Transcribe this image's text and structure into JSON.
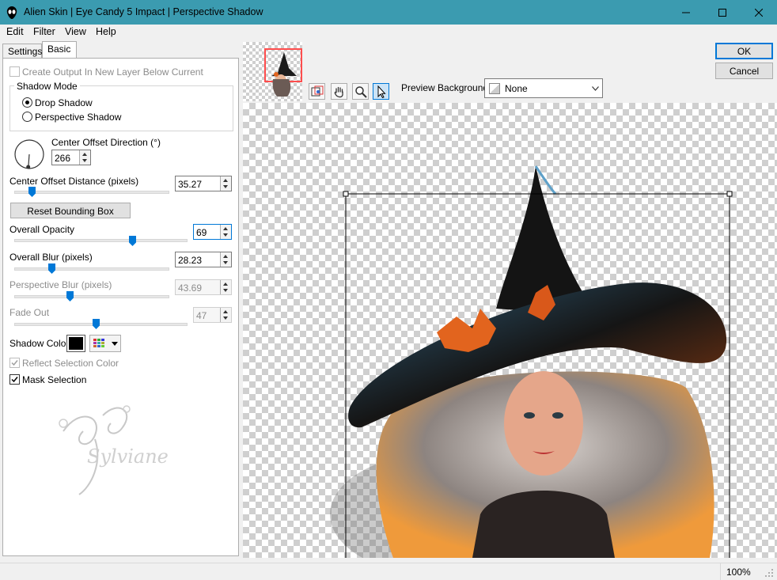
{
  "window": {
    "title": "Alien Skin | Eye Candy 5 Impact | Perspective Shadow",
    "controls": [
      "minimize-icon",
      "maximize-icon",
      "close-icon"
    ]
  },
  "menu": [
    "Edit",
    "Filter",
    "View",
    "Help"
  ],
  "tabs": [
    "Settings",
    "Basic"
  ],
  "active_tab": "Basic",
  "basic": {
    "create_output_label": "Create Output In New Layer Below Current",
    "shadow_mode": {
      "title": "Shadow Mode",
      "options": [
        "Drop Shadow",
        "Perspective Shadow"
      ],
      "selected": "Drop Shadow"
    },
    "direction": {
      "label": "Center Offset Direction (°)",
      "value": "266"
    },
    "distance": {
      "label": "Center Offset Distance (pixels)",
      "value": "35.27",
      "slider": 0.1
    },
    "reset_label": "Reset Bounding Box",
    "opacity": {
      "label": "Overall Opacity",
      "value": "69",
      "slider": 0.69
    },
    "blur": {
      "label": "Overall Blur (pixels)",
      "value": "28.23",
      "slider": 0.24
    },
    "perspective_blur": {
      "label": "Perspective Blur (pixels)",
      "value": "43.69",
      "slider": 0.36
    },
    "fade_out": {
      "label": "Fade Out",
      "value": "47",
      "slider": 0.47
    },
    "shadow_color": {
      "label": "Shadow Color",
      "value": "#000000"
    },
    "reflect_label": "Reflect Selection Color",
    "mask_label": "Mask Selection"
  },
  "watermark": "Sylviane",
  "preview_toolbar": {
    "tools": [
      "navigator-icon",
      "hand-icon",
      "zoom-icon",
      "pointer-icon"
    ],
    "background_label": "Preview Background:",
    "background_value": "None"
  },
  "buttons": {
    "ok": "OK",
    "cancel": "Cancel"
  },
  "status": {
    "zoom": "100%"
  },
  "colors": {
    "titlebar": "#3b9bb0",
    "accent": "#0078d7"
  }
}
